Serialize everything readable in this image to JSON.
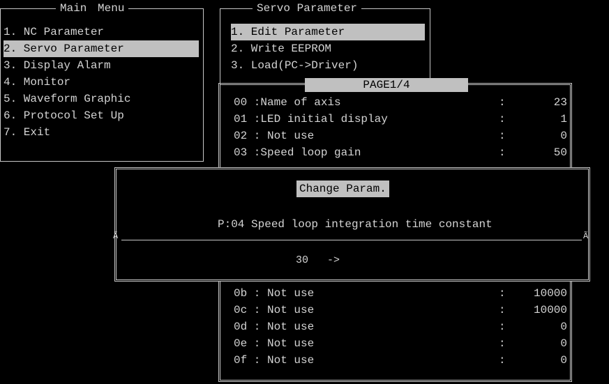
{
  "main_menu": {
    "title": "Main Menu",
    "items": [
      "1. NC Parameter",
      "2. Servo Parameter",
      "3. Display Alarm",
      "4. Monitor",
      "5. Waveform Graphic",
      "6. Protocol Set Up",
      "7. Exit"
    ],
    "selected_index": 1
  },
  "servo_menu": {
    "title": "Servo Parameter",
    "items": [
      "1. Edit Parameter",
      "2. Write EEPROM",
      "3. Load(PC->Driver)"
    ],
    "selected_index": 0
  },
  "param_page": {
    "page_label": "PAGE1/4",
    "top_rows": [
      {
        "code": "00 :Name of axis",
        "value": "23"
      },
      {
        "code": "01 :LED initial display",
        "value": "1"
      },
      {
        "code": "02 : Not use",
        "value": "0"
      },
      {
        "code": "03 :Speed loop gain",
        "value": "50"
      }
    ],
    "bottom_rows": [
      {
        "code": "0b : Not use",
        "value": "10000"
      },
      {
        "code": "0c : Not use",
        "value": "10000"
      },
      {
        "code": "0d : Not use",
        "value": "0"
      },
      {
        "code": "0e : Not use",
        "value": "0"
      },
      {
        "code": "0f : Not use",
        "value": "0"
      }
    ],
    "colon": ":"
  },
  "change_dialog": {
    "title": "Change Param.",
    "param_text": "P:04 Speed loop integration time constant",
    "left_glyph": "Ã",
    "right_glyph": "Ã",
    "value_text": "30   ->"
  },
  "colors": {
    "background": "#000000",
    "text": "#d4d4d4",
    "highlight_bg": "#c0c0c0",
    "highlight_text": "#000000"
  }
}
